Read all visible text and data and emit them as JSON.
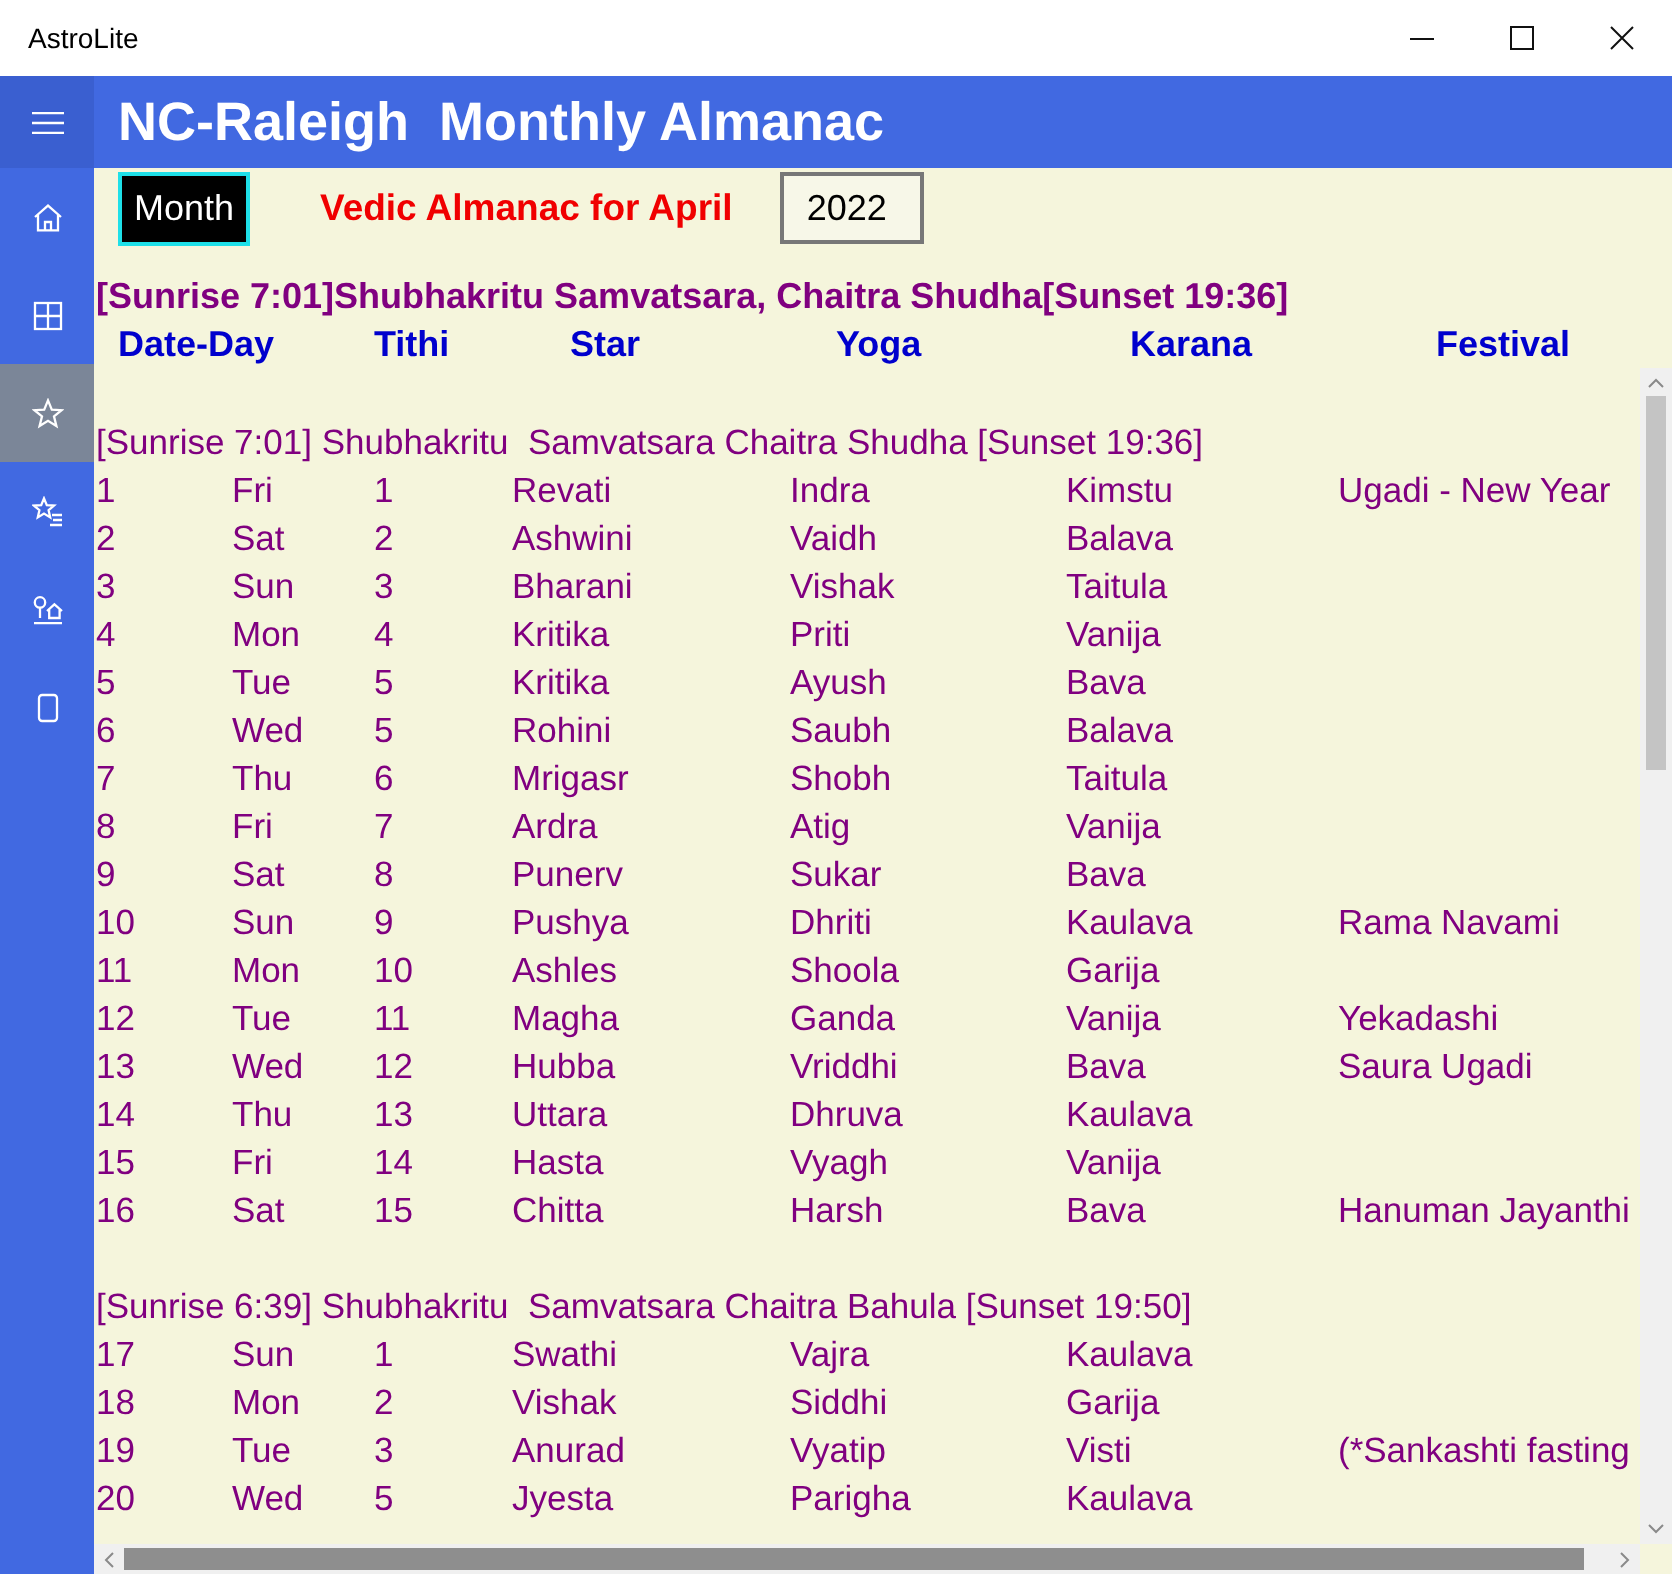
{
  "window": {
    "title": "AstroLite"
  },
  "sidebar": {
    "items": [
      {
        "selected": false
      },
      {
        "selected": false
      },
      {
        "selected": true
      },
      {
        "selected": false
      },
      {
        "selected": false
      },
      {
        "selected": false
      }
    ]
  },
  "header": {
    "title": "NC-Raleigh  Monthly Almanac"
  },
  "toolbar": {
    "month_button": "Month",
    "heading": "Vedic Almanac for April",
    "year_field": {
      "value": "2022"
    }
  },
  "summary": "[Sunrise 7:01]Shubhakritu Samvatsara, Chaitra Shudha[Sunset 19:36]",
  "table": {
    "columns": [
      "Date-Day",
      "Tithi",
      "Star",
      "Yoga",
      "Karana",
      "Festival"
    ],
    "sections": [
      {
        "heading": "[Sunrise 7:01] Shubhakritu  Samvatsara Chaitra Shudha [Sunset 19:36]",
        "rows": [
          {
            "date": "1",
            "day": "Fri",
            "tithi": "1",
            "star": "Revati",
            "yoga": "Indra",
            "karana": "Kimstu",
            "festival": "Ugadi - New Year"
          },
          {
            "date": "2",
            "day": "Sat",
            "tithi": "2",
            "star": "Ashwini",
            "yoga": "Vaidh",
            "karana": "Balava"
          },
          {
            "date": "3",
            "day": "Sun",
            "tithi": "3",
            "star": "Bharani",
            "yoga": "Vishak",
            "karana": "Taitula"
          },
          {
            "date": "4",
            "day": "Mon",
            "tithi": "4",
            "star": "Kritika",
            "yoga": "Priti",
            "karana": "Vanija"
          },
          {
            "date": "5",
            "day": "Tue",
            "tithi": "5",
            "star": "Kritika",
            "yoga": "Ayush",
            "karana": "Bava"
          },
          {
            "date": "6",
            "day": "Wed",
            "tithi": "5",
            "star": "Rohini",
            "yoga": "Saubh",
            "karana": "Balava"
          },
          {
            "date": "7",
            "day": "Thu",
            "tithi": "6",
            "star": "Mrigasr",
            "yoga": "Shobh",
            "karana": "Taitula"
          },
          {
            "date": "8",
            "day": "Fri",
            "tithi": "7",
            "star": "Ardra",
            "yoga": "Atig",
            "karana": "Vanija"
          },
          {
            "date": "9",
            "day": "Sat",
            "tithi": "8",
            "star": "Punerv",
            "yoga": "Sukar",
            "karana": "Bava"
          },
          {
            "date": "10",
            "day": "Sun",
            "tithi": "9",
            "star": "Pushya",
            "yoga": "Dhriti",
            "karana": "Kaulava",
            "festival": "Rama Navami"
          },
          {
            "date": "11",
            "day": "Mon",
            "tithi": "10",
            "star": "Ashles",
            "yoga": "Shoola",
            "karana": "Garija"
          },
          {
            "date": "12",
            "day": "Tue",
            "tithi": "11",
            "star": "Magha",
            "yoga": "Ganda",
            "karana": "Vanija",
            "festival": "Yekadashi"
          },
          {
            "date": "13",
            "day": "Wed",
            "tithi": "12",
            "star": "Hubba",
            "yoga": "Vriddhi",
            "karana": "Bava",
            "festival": "Saura Ugadi"
          },
          {
            "date": "14",
            "day": "Thu",
            "tithi": "13",
            "star": "Uttara",
            "yoga": "Dhruva",
            "karana": "Kaulava"
          },
          {
            "date": "15",
            "day": "Fri",
            "tithi": "14",
            "star": "Hasta",
            "yoga": "Vyagh",
            "karana": "Vanija"
          },
          {
            "date": "16",
            "day": "Sat",
            "tithi": "15",
            "star": "Chitta",
            "yoga": "Harsh",
            "karana": "Bava",
            "festival": "Hanuman Jayanthi"
          }
        ]
      },
      {
        "heading": "[Sunrise 6:39] Shubhakritu  Samvatsara Chaitra Bahula [Sunset 19:50]",
        "rows": [
          {
            "date": "17",
            "day": "Sun",
            "tithi": "1",
            "star": "Swathi",
            "yoga": "Vajra",
            "karana": "Kaulava"
          },
          {
            "date": "18",
            "day": "Mon",
            "tithi": "2",
            "star": "Vishak",
            "yoga": "Siddhi",
            "karana": "Garija"
          },
          {
            "date": "19",
            "day": "Tue",
            "tithi": "3",
            "star": "Anurad",
            "yoga": "Vyatip",
            "karana": "Visti",
            "festival": "(*Sankashti fasting"
          },
          {
            "date": "20",
            "day": "Wed",
            "tithi": "5",
            "star": "Jyesta",
            "yoga": "Parigha",
            "karana": "Kaulava"
          }
        ]
      }
    ]
  }
}
